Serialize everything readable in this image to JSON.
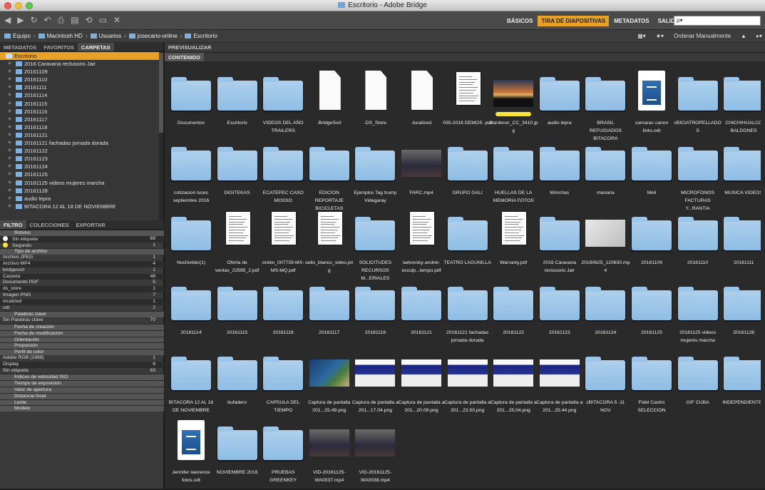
{
  "window": {
    "title": "Escritorio - Adobe Bridge"
  },
  "toolbar": {
    "workspaces": [
      "BÁSICOS",
      "TIRA DE DIAPOSITIVAS",
      "METADATOS",
      "SALIDA"
    ],
    "active_workspace": "TIRA DE DIAPOSITIVAS",
    "search_placeholder": "ρ▾"
  },
  "breadcrumb": [
    "Equipo",
    "Macintosh HD",
    "Usuarios",
    "josecario-online",
    "Escritorio"
  ],
  "view": {
    "sort_label": "Ordenar Manualmente"
  },
  "left_tabs": [
    "METADATOS",
    "FAVORITOS",
    "CARPETAS"
  ],
  "active_left_tab": "CARPETAS",
  "folders": [
    "Escritorio",
    "2016 Caravana reclusorio Jair",
    "20161109",
    "20161110",
    "20161111",
    "20161114",
    "20161115",
    "20161116",
    "20161117",
    "20161118",
    "20161121",
    "20161121 fachadas jornada dorada",
    "20161122",
    "20161123",
    "20161124",
    "20161125",
    "20161125 videos mujeres marcha",
    "20161128",
    "audio lepra",
    "BITACORA 12 AL 18 DE NOVIEMBRE"
  ],
  "filter_tabs": [
    "FILTRO",
    "COLECCIONES",
    "EXPORTAR"
  ],
  "filters": [
    {
      "kind": "cat",
      "label": "Rótulos"
    },
    {
      "kind": "item",
      "label": "Sin etiqueta",
      "count": "69",
      "dot": "#ffffff"
    },
    {
      "kind": "item",
      "label": "Segundo",
      "count": "1",
      "dot": "#f5e53a"
    },
    {
      "kind": "cat",
      "label": "Tipo de archivo"
    },
    {
      "kind": "item",
      "label": "Archivo JPEG",
      "count": "1"
    },
    {
      "kind": "item",
      "label": "Archivo MP4",
      "count": "4"
    },
    {
      "kind": "item",
      "label": "bridgesort",
      "count": "1"
    },
    {
      "kind": "item",
      "label": "Carpeta",
      "count": "48"
    },
    {
      "kind": "item",
      "label": "Documento PDF",
      "count": "5"
    },
    {
      "kind": "item",
      "label": "ds_store",
      "count": "1"
    },
    {
      "kind": "item",
      "label": "Imagen PNG",
      "count": "7"
    },
    {
      "kind": "item",
      "label": "localized",
      "count": "1"
    },
    {
      "kind": "item",
      "label": "odt",
      "count": "2"
    },
    {
      "kind": "cat",
      "label": "Palabras clave"
    },
    {
      "kind": "item",
      "label": "Sin Palabras clave",
      "count": "70"
    },
    {
      "kind": "cat",
      "label": "Fecha de creación"
    },
    {
      "kind": "cat",
      "label": "Fecha de modificación"
    },
    {
      "kind": "cat",
      "label": "Orientación"
    },
    {
      "kind": "cat",
      "label": "Proporción"
    },
    {
      "kind": "cat",
      "label": "Perfil de color"
    },
    {
      "kind": "item",
      "label": "Adobe RGB (1998)",
      "count": "1"
    },
    {
      "kind": "item",
      "label": "Display",
      "count": "6"
    },
    {
      "kind": "item",
      "label": "Sin etiqueta",
      "count": "63"
    },
    {
      "kind": "cat",
      "label": "Índices de velocidad ISO"
    },
    {
      "kind": "cat",
      "label": "Tiempo de exposición"
    },
    {
      "kind": "cat",
      "label": "Valor de apertura"
    },
    {
      "kind": "cat",
      "label": "Distancia focal"
    },
    {
      "kind": "cat",
      "label": "Lente"
    },
    {
      "kind": "cat",
      "label": "Modelo"
    }
  ],
  "panels": {
    "preview": "PREVISUALIZAR",
    "content": "CONTENIDO"
  },
  "items": [
    {
      "name": "Documentos",
      "type": "folder"
    },
    {
      "name": "Escritorio",
      "type": "folder"
    },
    {
      "name": "VIDEOS DEL AÑO TRAILERS",
      "type": "folder"
    },
    {
      "name": ".BridgeSort",
      "type": "doc"
    },
    {
      "name": ".DS_Store",
      "type": "doc"
    },
    {
      "name": ".localized",
      "type": "doc"
    },
    {
      "name": "035-2016 DEMOS .pdf",
      "type": "pdf"
    },
    {
      "name": "atardecer_CC_3410.jpg",
      "type": "sunset",
      "label": true
    },
    {
      "name": "audio lepra",
      "type": "folder"
    },
    {
      "name": "BRASIL REFUGIADOS BITACORA",
      "type": "folder"
    },
    {
      "name": "camaras canon links.odt",
      "type": "odt"
    },
    {
      "name": "cBICIATROPELLADOS",
      "type": "folder"
    },
    {
      "name": "CHICHIHUALCO BALDONES",
      "type": "folder"
    },
    {
      "name": "cotizacion luces septiembre 2016",
      "type": "folder"
    },
    {
      "name": "DIGITEKAS",
      "type": "folder"
    },
    {
      "name": "ECATEPEC CASO MOSSO",
      "type": "folder"
    },
    {
      "name": "EDICION REPORTAJE BICICLETAS",
      "type": "folder"
    },
    {
      "name": "Ejemplos Tag trump Videgaray",
      "type": "folder"
    },
    {
      "name": "FARC.mp4",
      "type": "video"
    },
    {
      "name": "GRUPO GALI",
      "type": "folder"
    },
    {
      "name": "HUELLAS DE LA MEMORIA FOTOS",
      "type": "folder"
    },
    {
      "name": "MArchas",
      "type": "folder"
    },
    {
      "name": "mariana",
      "type": "folder"
    },
    {
      "name": "Meli",
      "type": "folder"
    },
    {
      "name": "MICROFONOS FACTURAS Y...RANTIA",
      "type": "folder"
    },
    {
      "name": "MUSICA VIDEOS",
      "type": "folder"
    },
    {
      "name": "Nochixtlán(1)",
      "type": "folder"
    },
    {
      "name": "Oferta de ventas_22595_2.pdf",
      "type": "pdf"
    },
    {
      "name": "orden_007739-MX-MS-MQ.pdf",
      "type": "pdf"
    },
    {
      "name": "sello_blanco_video.png",
      "type": "pdf"
    },
    {
      "name": "SOLICITUDES RECURSOS M...ERIALES",
      "type": "folder"
    },
    {
      "name": "tarkovsky-andrei-esculp...lempo.pdf",
      "type": "pdf"
    },
    {
      "name": "TEATRO LAGUNILLA",
      "type": "folder"
    },
    {
      "name": "Warranty.pdf",
      "type": "pdf"
    },
    {
      "name": "2016 Caravana reclusorio Jair",
      "type": "folder"
    },
    {
      "name": "20160625_120630.mp4",
      "type": "floor"
    },
    {
      "name": "20161109",
      "type": "folder"
    },
    {
      "name": "20161110",
      "type": "folder"
    },
    {
      "name": "20161111",
      "type": "folder"
    },
    {
      "name": "20161114",
      "type": "folder"
    },
    {
      "name": "20161115",
      "type": "folder"
    },
    {
      "name": "20161116",
      "type": "folder"
    },
    {
      "name": "20161117",
      "type": "folder"
    },
    {
      "name": "20161118",
      "type": "folder"
    },
    {
      "name": "20161121",
      "type": "folder"
    },
    {
      "name": "20161121 fachadas jornada dorada",
      "type": "folder"
    },
    {
      "name": "20161122",
      "type": "folder"
    },
    {
      "name": "20161123",
      "type": "folder"
    },
    {
      "name": "20161124",
      "type": "folder"
    },
    {
      "name": "20161125",
      "type": "folder"
    },
    {
      "name": "20161125 videos mujeres marcha",
      "type": "folder"
    },
    {
      "name": "20161128",
      "type": "folder"
    },
    {
      "name": "BITACORA 12 AL 18 DE NOVIEMBRE",
      "type": "folder"
    },
    {
      "name": "bufadero",
      "type": "folder"
    },
    {
      "name": "CAPSULA DEL TIEMPO",
      "type": "folder"
    },
    {
      "name": "Captura de pantalla 201...25.49.png",
      "type": "map"
    },
    {
      "name": "Captura de pantalla a 201...17.04.png",
      "type": "shot"
    },
    {
      "name": "Captura de pantalla a 201...20.09.png",
      "type": "shot"
    },
    {
      "name": "Captura de pantalla a 201...23.50.png",
      "type": "shot"
    },
    {
      "name": "Captura de pantalla a 201...25.04.png",
      "type": "shot"
    },
    {
      "name": "Captura de pantalla a 201...25.44.png",
      "type": "shot"
    },
    {
      "name": "cBITACORA 5 -11 NOV",
      "type": "folder"
    },
    {
      "name": "Fidel Castro SELECCION",
      "type": "folder"
    },
    {
      "name": "GIF CUBA",
      "type": "folder"
    },
    {
      "name": "INDEPENDIENTES",
      "type": "folder"
    },
    {
      "name": "Jennifer lawrence fotos.odt",
      "type": "odt"
    },
    {
      "name": "NOVIEMBRE 2016",
      "type": "folder"
    },
    {
      "name": "PRUEBAS GREENKEY",
      "type": "folder"
    },
    {
      "name": "VID-20161125-WA0037.mp4",
      "type": "video"
    },
    {
      "name": "VID-20161125-WA0038.mp4",
      "type": "video"
    }
  ]
}
